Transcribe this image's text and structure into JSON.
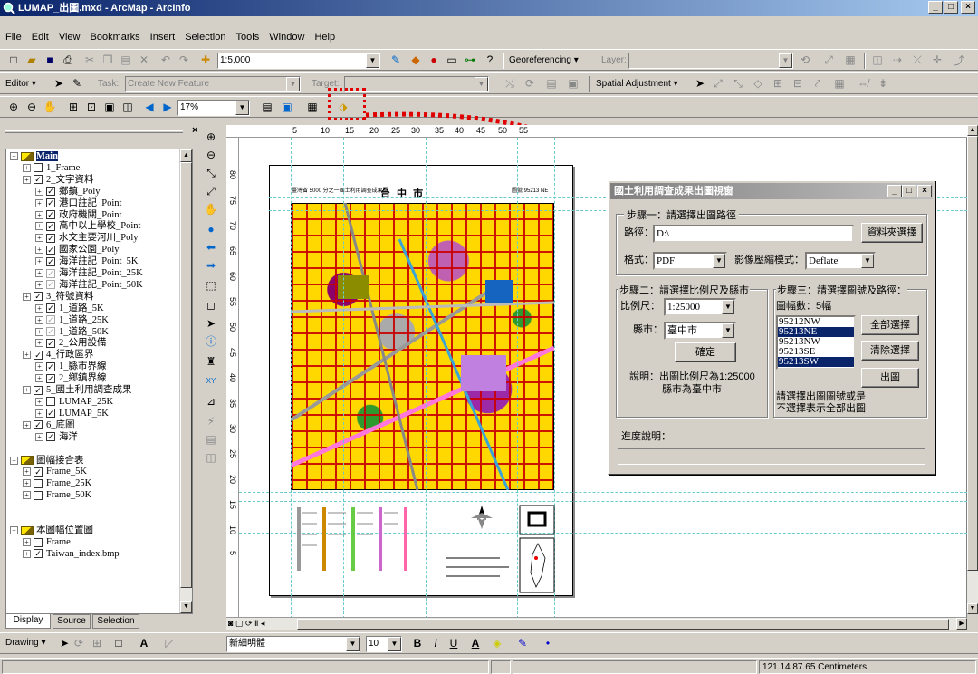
{
  "window": {
    "title": "LUMAP_出圖.mxd - ArcMap - ArcInfo",
    "min": "_",
    "max": "□",
    "close": "×"
  },
  "menu": [
    "File",
    "Edit",
    "View",
    "Bookmarks",
    "Insert",
    "Selection",
    "Tools",
    "Window",
    "Help"
  ],
  "toolbar1": {
    "scale": "1:5,000",
    "georef": "Georeferencing ▾",
    "layer_label": "Layer:"
  },
  "toolbar2": {
    "editor": "Editor ▾",
    "task_label": "Task:",
    "task_value": "Create New Feature",
    "target_label": "Target:",
    "spatial": "Spatial Adjustment ▾"
  },
  "toolbar3": {
    "zoom": "17%"
  },
  "toc": {
    "items": [
      {
        "label": "Main",
        "level": 0,
        "type": "frame",
        "bold": true
      },
      {
        "label": "1_Frame",
        "level": 1,
        "check": "none",
        "expand": true
      },
      {
        "label": "2_文字資料",
        "level": 1,
        "check": "on",
        "expand": true
      },
      {
        "label": "鄉鎮_Poly",
        "level": 2,
        "check": "on",
        "expand": true
      },
      {
        "label": "港口註記_Point",
        "level": 2,
        "check": "on",
        "expand": true
      },
      {
        "label": "政府機關_Point",
        "level": 2,
        "check": "on",
        "expand": true
      },
      {
        "label": "高中以上學校_Point",
        "level": 2,
        "check": "on",
        "expand": true
      },
      {
        "label": "水文主要河川_Poly",
        "level": 2,
        "check": "on",
        "expand": true
      },
      {
        "label": "國家公園_Poly",
        "level": 2,
        "check": "on",
        "expand": true
      },
      {
        "label": "海洋註記_Point_5K",
        "level": 2,
        "check": "on",
        "expand": true
      },
      {
        "label": "海洋註記_Point_25K",
        "level": 2,
        "check": "gray",
        "expand": true
      },
      {
        "label": "海洋註記_Point_50K",
        "level": 2,
        "check": "gray",
        "expand": true
      },
      {
        "label": "3_符號資料",
        "level": 1,
        "check": "on",
        "expand": true
      },
      {
        "label": "1_道路_5K",
        "level": 2,
        "check": "on",
        "expand": true
      },
      {
        "label": "1_道路_25K",
        "level": 2,
        "check": "gray",
        "expand": true
      },
      {
        "label": "1_道路_50K",
        "level": 2,
        "check": "gray",
        "expand": true
      },
      {
        "label": "2_公用設備",
        "level": 2,
        "check": "on",
        "expand": true
      },
      {
        "label": "4_行政區界",
        "level": 1,
        "check": "on",
        "expand": true
      },
      {
        "label": "1_縣市界線",
        "level": 2,
        "check": "on",
        "expand": true
      },
      {
        "label": "2_鄉鎮界線",
        "level": 2,
        "check": "on",
        "expand": true
      },
      {
        "label": "5_國土利用調查成果",
        "level": 1,
        "check": "on",
        "expand": true
      },
      {
        "label": "LUMAP_25K",
        "level": 2,
        "check": "none",
        "expand": true
      },
      {
        "label": "LUMAP_5K",
        "level": 2,
        "check": "on",
        "expand": true
      },
      {
        "label": "6_底圖",
        "level": 1,
        "check": "on",
        "expand": true
      },
      {
        "label": "海洋",
        "level": 2,
        "check": "on",
        "expand": true
      },
      {
        "label": "",
        "level": -1
      },
      {
        "label": "圖幅接合表",
        "level": 0,
        "type": "frame"
      },
      {
        "label": "Frame_5K",
        "level": 1,
        "check": "on",
        "expand": true
      },
      {
        "label": "Frame_25K",
        "level": 1,
        "check": "none",
        "expand": true
      },
      {
        "label": "Frame_50K",
        "level": 1,
        "check": "none",
        "expand": true
      },
      {
        "label": "",
        "level": -1
      },
      {
        "label": "",
        "level": -1
      },
      {
        "label": "本圖幅位置圖",
        "level": 0,
        "type": "frame"
      },
      {
        "label": "Frame",
        "level": 1,
        "check": "none",
        "expand": true
      },
      {
        "label": "Taiwan_index.bmp",
        "level": 1,
        "check": "on",
        "expand": true
      }
    ],
    "tabs": [
      "Display",
      "Source",
      "Selection"
    ]
  },
  "ruler": {
    "h": [
      "5",
      "10",
      "15",
      "20",
      "25",
      "30",
      "35",
      "40",
      "45",
      "50",
      "55"
    ],
    "v": [
      "80",
      "75",
      "70",
      "65",
      "60",
      "55",
      "50",
      "45",
      "40",
      "35",
      "30",
      "25",
      "20",
      "15",
      "10",
      "5"
    ]
  },
  "map": {
    "title": "台  中  市",
    "header_left": "臺灣省 5000 分之一國土利用調查成果圖",
    "header_right": "圖號 95213 NE"
  },
  "dialog": {
    "title": "國土利用調查成果出圖視窗",
    "step1": "步驟一：請選擇出圖路徑",
    "path_label": "路徑：",
    "path_value": "D:\\",
    "folder_btn": "資料夾選擇",
    "format_label": "格式：",
    "format_value": "PDF",
    "compress_label": "影像壓縮模式：",
    "compress_value": "Deflate",
    "step2": "步驟二：請選擇比例尺及縣市",
    "scale_label": "比例尺：",
    "scale_value": "1:25000",
    "county_label": "縣市：",
    "county_value": "臺中市",
    "confirm_btn": "確定",
    "note": "說明：出圖比例尺為1:25000",
    "note2": "縣市為臺中市",
    "step3": "步驟三：請選擇圖號及路徑：",
    "count": "圖幅數：5幅",
    "sheets": [
      {
        "id": "95212NW",
        "sel": false
      },
      {
        "id": "95213NE",
        "sel": true
      },
      {
        "id": "95213NW",
        "sel": false
      },
      {
        "id": "95213SE",
        "sel": false
      },
      {
        "id": "95213SW",
        "sel": true
      }
    ],
    "select_all": "全部選擇",
    "clear": "清除選擇",
    "output": "出圖",
    "hint1": "請選擇出圖圖號或是",
    "hint2": "不選擇表示全部出圖",
    "progress_label": "進度說明："
  },
  "drawbar": {
    "drawing": "Drawing ▾",
    "font": "新細明體",
    "size": "10",
    "b": "B",
    "i": "I",
    "u": "U",
    "a": "A"
  },
  "status": {
    "coords": "121.14  87.65 Centimeters"
  },
  "colors": {
    "title_active": "#0a246a",
    "title_inactive": "#808080",
    "highlight": "#e00000"
  }
}
